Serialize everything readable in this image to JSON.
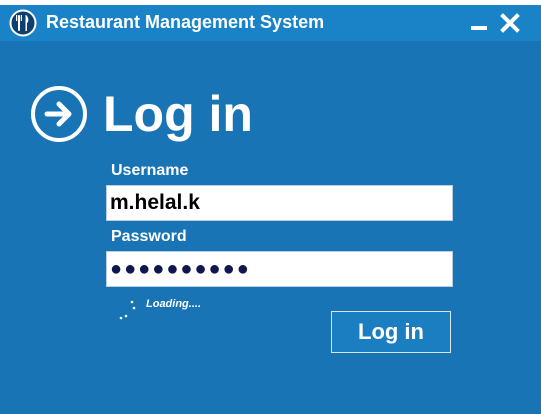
{
  "window": {
    "title": "Restaurant Management System",
    "minimize_symbol": "—",
    "close_symbol": "✕"
  },
  "header": {
    "heading": "Log in",
    "arrow_icon": "circle-right-arrow-icon"
  },
  "form": {
    "username_label": "Username",
    "username_value": "m.helal.k",
    "password_label": "Password",
    "password_mask": "●●●●●●●●●●",
    "loading_text": "Loading....",
    "login_button_label": "Log in"
  },
  "colors": {
    "window_background": "#1874b5",
    "titlebar_background": "#1a82c6",
    "text": "#ffffff",
    "password_dots": "#10174f"
  }
}
